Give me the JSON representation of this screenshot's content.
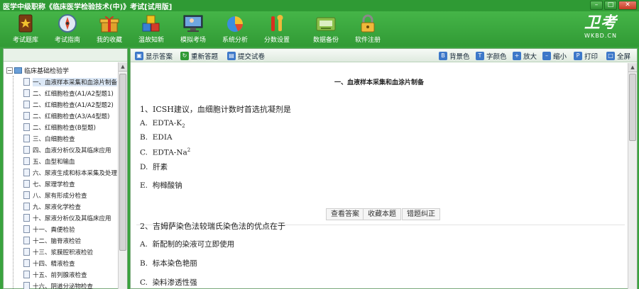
{
  "window": {
    "title": "医学中级职称《临床医学检验技术(中)》考试[试用版]",
    "minimize": "–",
    "maximize": "□",
    "close": "✕"
  },
  "toolbar": {
    "items": [
      {
        "label": "考试题库",
        "icon": "book-icon"
      },
      {
        "label": "考试指南",
        "icon": "compass-icon"
      },
      {
        "label": "我的收藏",
        "icon": "gift-box-icon"
      },
      {
        "label": "温故知新",
        "icon": "cubes-icon"
      },
      {
        "label": "模拟考场",
        "icon": "monitor-icon"
      },
      {
        "label": "系统分析",
        "icon": "pie-chart-icon"
      },
      {
        "label": "分数设置",
        "icon": "tools-icon"
      },
      {
        "label": "数据备份",
        "icon": "disk-icon"
      },
      {
        "label": "软件注册",
        "icon": "lock-icon"
      }
    ],
    "logo_main": "卫考",
    "logo_sub": "WKBD.CN"
  },
  "tree": {
    "root": "临床基础检验学",
    "items": [
      "一、血液样本采集和血涂片制备",
      "二、红细胞检查(A1/A2型题1)",
      "二、红细胞检查(A1/A2型题2)",
      "二、红细胞检查(A3/A4型题)",
      "二、红细胞检查(B型题)",
      "三、白细胞检查",
      "四、血液分析仪及其临床应用",
      "五、血型和输血",
      "六、尿液生成和标本采集及处理",
      "七、尿理学检查",
      "八、尿有形成分检查",
      "九、尿液化学检查",
      "十、尿液分析仪及其临床应用",
      "十一、粪便检验",
      "十二、脑脊液检验",
      "十三、浆膜腔积液检验",
      "十四、精液检查",
      "十五、前列腺液检查",
      "十六、阴道分泌物检查"
    ],
    "selected_index": 0
  },
  "content_toolbar": {
    "left": [
      {
        "label": "显示答案",
        "icon": "show-answer-icon"
      },
      {
        "label": "重新答题",
        "icon": "redo-icon"
      },
      {
        "label": "提交试卷",
        "icon": "submit-icon"
      }
    ],
    "right": [
      {
        "label": "背景色",
        "glyph": "B",
        "icon": "background-color-icon"
      },
      {
        "label": "字颜色",
        "glyph": "T",
        "icon": "font-color-icon"
      },
      {
        "label": "放大",
        "glyph": "+",
        "icon": "zoom-in-icon"
      },
      {
        "label": "缩小",
        "glyph": "–",
        "icon": "zoom-out-icon"
      },
      {
        "label": "打印",
        "glyph": "P",
        "icon": "print-icon"
      },
      {
        "label": "全屏",
        "glyph": "□",
        "icon": "fullscreen-icon"
      }
    ],
    "colors": {
      "accent": "#3d78c9",
      "green": "#319a35"
    }
  },
  "content": {
    "section_title": "一、血液样本采集和血涂片制备",
    "questions": [
      {
        "text": "1、ICSH建议，血细胞计数时首选抗凝剂是",
        "options": [
          {
            "prefix": "A.",
            "text": "EDTA-K",
            "sub": "2"
          },
          {
            "prefix": "B.",
            "text": "EDIA",
            "sub": ""
          },
          {
            "prefix": "C.",
            "text": "EDTA-Na",
            "sub": "2"
          },
          {
            "prefix": "D.",
            "text": "肝素",
            "sub": ""
          },
          {
            "prefix": "E.",
            "text": "枸橼酸钠",
            "sub": ""
          }
        ],
        "actions": [
          "查看答案",
          "收藏本题",
          "错题纠正"
        ]
      },
      {
        "text": "2、吉姆萨染色法较瑞氏染色法的优点在于",
        "options": [
          {
            "prefix": "A.",
            "text": "新配制的染液可立即使用",
            "sub": ""
          },
          {
            "prefix": "B.",
            "text": "标本染色艳丽",
            "sub": ""
          },
          {
            "prefix": "C.",
            "text": "染料渗透性强",
            "sub": ""
          }
        ]
      }
    ]
  }
}
